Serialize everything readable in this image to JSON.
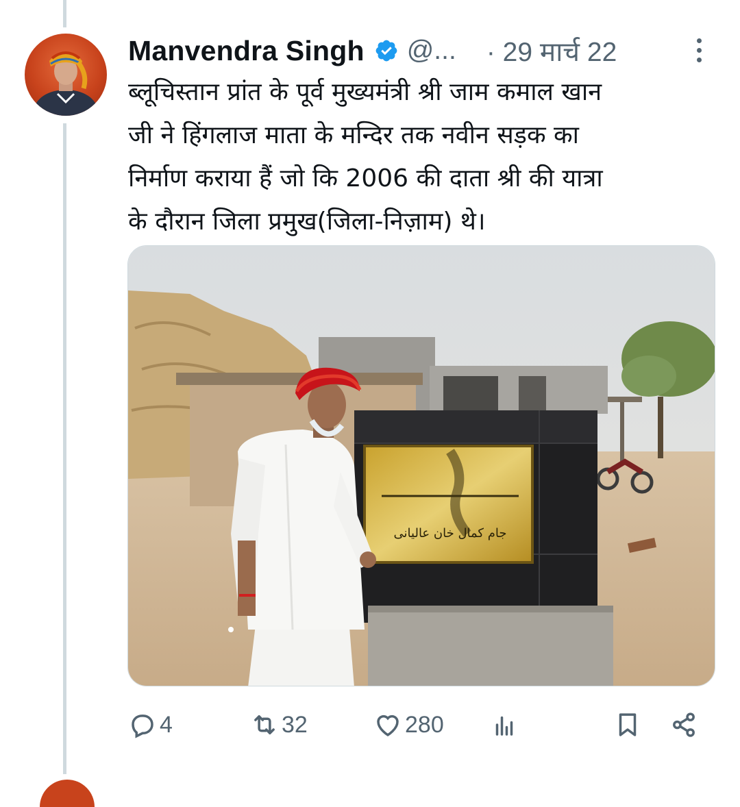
{
  "tweet": {
    "author": {
      "display_name": "Manvendra Singh",
      "handle": "@...",
      "verified": true
    },
    "date": "· 29 मार्च 22",
    "text_lines": [
      "ब्लूचिस्तान प्रांत के पूर्व मुख्यमंत्री श्री जाम कमाल खान",
      "जी ने हिंगलाज माता के मन्दिर तक नवीन सड़क का",
      "निर्माण कराया हैं जो कि 2006 की दाता श्री की यात्रा",
      "के दौरान जिला प्रमुख(जिला-निज़ाम) थे।"
    ],
    "media": {
      "plaque_text": "جام کمال خان عالیانی"
    },
    "actions": {
      "replies": "4",
      "retweets": "32",
      "likes": "280"
    }
  },
  "icons": {
    "verified": "verified-badge-icon",
    "more": "more-options-icon",
    "reply": "reply-icon",
    "retweet": "retweet-icon",
    "like": "heart-icon",
    "views": "views-chart-icon",
    "bookmark": "bookmark-icon",
    "share": "share-icon"
  },
  "colors": {
    "verified_blue": "#1d9bf0",
    "secondary_text": "#536471",
    "primary_text": "#0f1419",
    "thread_line": "#cfd9de"
  }
}
